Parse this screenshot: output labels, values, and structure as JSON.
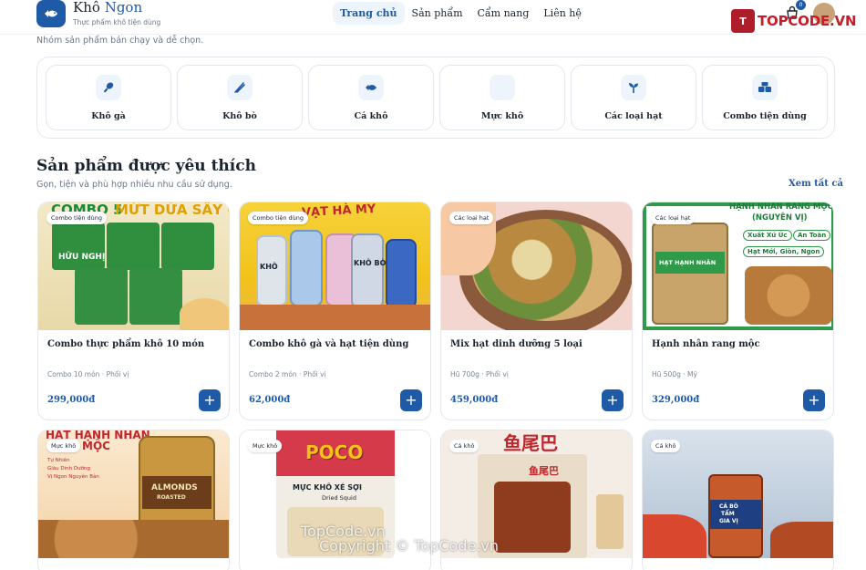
{
  "header": {
    "brand_first": "Khô",
    "brand_second": "Ngon",
    "tagline": "Thực phẩm khô tiện dùng",
    "nav": [
      "Trang chủ",
      "Sản phẩm",
      "Cẩm nang",
      "Liên hệ"
    ],
    "cart_count": "0",
    "logo_icon": "fish-icon"
  },
  "watermark": {
    "top_brand": "TOPCODE.VN",
    "top_icon_letter": "T",
    "bottom_line1": "TopCode.vn",
    "bottom_line2": "Copyright © TopCode.vn"
  },
  "categories": {
    "intro": "Nhóm sản phẩm bán chạy và dễ chọn.",
    "items": [
      {
        "label": "Khô gà",
        "icon": "drumstick-icon"
      },
      {
        "label": "Khô bò",
        "icon": "jerky-icon"
      },
      {
        "label": "Cá khô",
        "icon": "fish-icon"
      },
      {
        "label": "Mực khô",
        "icon": "squid-icon"
      },
      {
        "label": "Các loại hạt",
        "icon": "seedling-icon"
      },
      {
        "label": "Combo tiện dùng",
        "icon": "boxes-icon"
      }
    ]
  },
  "section": {
    "title": "Sản phẩm được yêu thích",
    "subtitle": "Gọn, tiện và phù hợp nhiều nhu cầu sử dụng.",
    "see_all": "Xem tất cả"
  },
  "products": [
    {
      "badge": "Combo tiện dùng",
      "name": "Combo thực phẩm khô 10 món",
      "meta": "Combo 10 món · Phối vị",
      "price": "299,000đ",
      "image_text": [
        "COMBO 5",
        "MỨT DỪA SẤY GIÒN",
        "HỮU NGHỊ"
      ]
    },
    {
      "badge": "Combo tiện dùng",
      "name": "Combo khô gà và hạt tiện dùng",
      "meta": "Combo 2 món · Phối vị",
      "price": "62,000đ",
      "image_text": [
        "VẠT HÀ MY",
        "KHÔ",
        "KHÔ BÒ"
      ]
    },
    {
      "badge": "Các loại hạt",
      "name": "Mix hạt dinh dưỡng 5 loại",
      "meta": "Hũ 700g · Phối vị",
      "price": "459,000đ",
      "image_text": []
    },
    {
      "badge": "Các loại hạt",
      "name": "Hạnh nhân rang mộc",
      "meta": "Hũ 500g · Mỹ",
      "price": "329,000đ",
      "image_text": [
        "HẠNH NHÂN RANG MỘC",
        "(NGUYÊN VỊ)",
        "Xuất Xứ Úc",
        "An Toàn",
        "Hạt Mới, Giòn, Ngon",
        "HẠT HẠNH NHÂN"
      ]
    },
    {
      "badge": "Mực khô",
      "name": "",
      "meta": "",
      "price": "",
      "image_text": [
        "HẠT HẠNH NHÂN",
        "MỘC",
        "Tự Nhiên",
        "Giàu Dinh Dưỡng",
        "Vị Ngon Nguyên Bản",
        "ALMONDS",
        "ROASTED"
      ]
    },
    {
      "badge": "Mực khô",
      "name": "",
      "meta": "",
      "price": "",
      "image_text": [
        "POCO",
        "MỰC KHÔ XÉ SỢI",
        "Dried Squid"
      ]
    },
    {
      "badge": "Cá khô",
      "name": "",
      "meta": "",
      "price": "",
      "image_text": [
        "鱼尾巴",
        "鱼尾巴"
      ]
    },
    {
      "badge": "Cá khô",
      "name": "",
      "meta": "",
      "price": "",
      "image_text": [
        "CÁ BÒ",
        "TẨM",
        "GIA VỊ"
      ]
    }
  ],
  "colors": {
    "primary": "#1f5aa6",
    "soft": "#eef4fc",
    "border": "#e3e8ef",
    "muted": "#6b7685"
  }
}
